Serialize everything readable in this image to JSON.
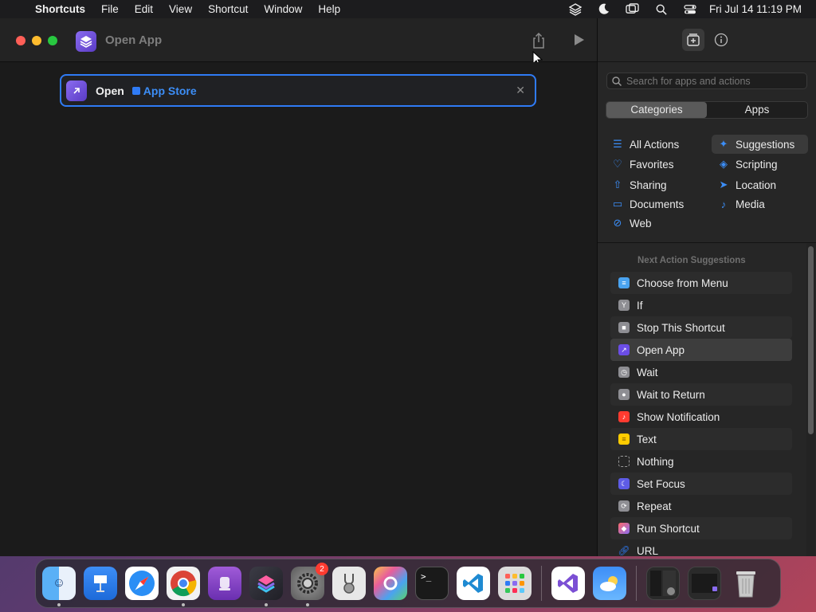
{
  "menubar": {
    "apple_icon": "apple-logo",
    "app_name": "Shortcuts",
    "items": [
      "File",
      "Edit",
      "View",
      "Shortcut",
      "Window",
      "Help"
    ],
    "clock": "Fri Jul 14  11:19 PM"
  },
  "window": {
    "title": "Open App",
    "action": {
      "verb": "Open",
      "param": "App Store"
    }
  },
  "pane": {
    "search_placeholder": "Search for apps and actions",
    "segments": [
      "Categories",
      "Apps"
    ],
    "active_segment": "Categories",
    "categories": [
      {
        "label": "All Actions",
        "icon": "list-icon"
      },
      {
        "label": "Suggestions",
        "icon": "sparkles-icon",
        "selected": true
      },
      {
        "label": "Favorites",
        "icon": "heart-icon"
      },
      {
        "label": "Scripting",
        "icon": "scripting-icon"
      },
      {
        "label": "Sharing",
        "icon": "share-icon"
      },
      {
        "label": "Location",
        "icon": "location-arrow-icon"
      },
      {
        "label": "Documents",
        "icon": "document-icon"
      },
      {
        "label": "Media",
        "icon": "music-note-icon"
      },
      {
        "label": "Web",
        "icon": "compass-icon"
      }
    ],
    "suggestions_heading": "Next Action Suggestions",
    "suggestions": [
      {
        "label": "Choose from Menu",
        "icon": "menu-icon",
        "color": "#4aa3f0"
      },
      {
        "label": "If",
        "icon": "branch-icon",
        "color": "#8e8e93"
      },
      {
        "label": "Stop This Shortcut",
        "icon": "stop-icon",
        "color": "#8e8e93"
      },
      {
        "label": "Open App",
        "icon": "open-app-icon",
        "color": "#6b4de6",
        "selected": true
      },
      {
        "label": "Wait",
        "icon": "clock-icon",
        "color": "#8e8e93"
      },
      {
        "label": "Wait to Return",
        "icon": "person-icon",
        "color": "#8e8e93"
      },
      {
        "label": "Show Notification",
        "icon": "bell-icon",
        "color": "#ff3b30"
      },
      {
        "label": "Text",
        "icon": "text-icon",
        "color": "#ffcc00"
      },
      {
        "label": "Nothing",
        "icon": "dashed-square-icon",
        "color": "#3a3a3a"
      },
      {
        "label": "Set Focus",
        "icon": "moon-icon",
        "color": "#5e5ce6"
      },
      {
        "label": "Repeat",
        "icon": "repeat-icon",
        "color": "#8e8e93"
      },
      {
        "label": "Run Shortcut",
        "icon": "shortcuts-icon",
        "color": "#c850c0"
      },
      {
        "label": "URL",
        "icon": "link-icon",
        "color": "#2f7bf5"
      }
    ]
  },
  "dock": {
    "apps": [
      {
        "name": "finder-icon",
        "running": true
      },
      {
        "name": "keynote-icon",
        "running": false
      },
      {
        "name": "safari-icon",
        "running": false
      },
      {
        "name": "chrome-icon",
        "running": true
      },
      {
        "name": "podcasts-icon",
        "running": false
      },
      {
        "name": "shortcuts-icon",
        "running": true
      },
      {
        "name": "system-settings-icon",
        "running": true,
        "badge": "2"
      },
      {
        "name": "disk-utility-icon",
        "running": false
      },
      {
        "name": "colorsync-icon",
        "running": false
      },
      {
        "name": "terminal-icon",
        "running": false
      },
      {
        "name": "vscode-icon",
        "running": false
      },
      {
        "name": "launchpad-icon",
        "running": false
      },
      {
        "name": "visual-studio-icon",
        "running": false
      },
      {
        "name": "weather-icon",
        "running": false
      },
      {
        "name": "window-thumbnail-1",
        "running": false
      },
      {
        "name": "window-thumbnail-2",
        "running": false
      },
      {
        "name": "trash-icon",
        "running": false
      }
    ]
  }
}
